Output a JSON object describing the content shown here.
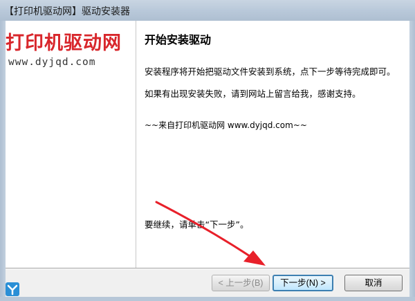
{
  "window": {
    "title": "【打印机驱动网】驱动安装器"
  },
  "sidebar": {
    "logo_text": "打印机驱动网",
    "logo_url": "www.dyjqd.com"
  },
  "content": {
    "heading": "开始安装驱动",
    "paragraph_1": "安装程序将开始把驱动文件安装到系统，点下一步等待完成即可。",
    "paragraph_2": "如果有出现安装失败，请到网站上留言给我，感谢支持。",
    "signature": "~~来自打印机驱动网 www.dyjqd.com~~",
    "continue_text": "要继续，请单击“下一步”。"
  },
  "buttons": {
    "back_label": "< 上一步(B)",
    "next_label": "下一步(N) >",
    "cancel_label": "取消"
  },
  "colors": {
    "logo_red": "#d8262b",
    "arrow_red": "#e8202a",
    "default_button_border": "#3c7fb1"
  },
  "icons": {
    "corner": "app-logo-icon"
  }
}
